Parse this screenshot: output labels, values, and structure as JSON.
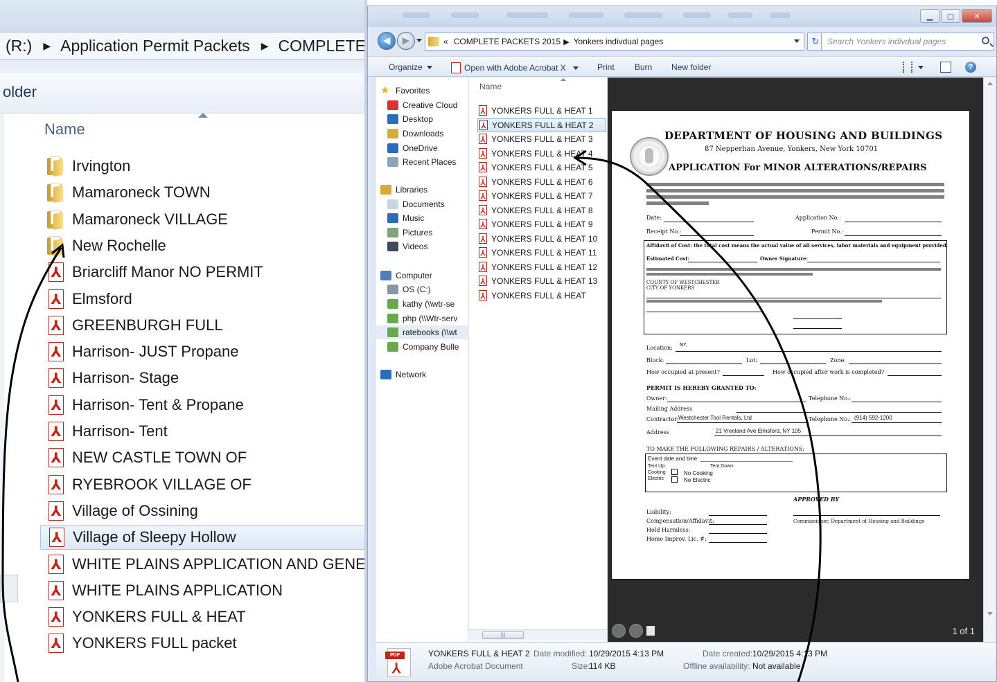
{
  "left_zoom": {
    "breadcrumb": [
      "(R:)",
      "Application Permit Packets",
      "COMPLETE PA"
    ],
    "command": "older",
    "column_header": "Name",
    "items": [
      {
        "label": "Irvington",
        "type": "folder"
      },
      {
        "label": "Mamaroneck TOWN",
        "type": "folder"
      },
      {
        "label": "Mamaroneck VILLAGE",
        "type": "folder"
      },
      {
        "label": "New Rochelle",
        "type": "folder"
      },
      {
        "label": "Briarcliff Manor NO PERMIT",
        "type": "pdf"
      },
      {
        "label": "Elmsford",
        "type": "pdf"
      },
      {
        "label": "GREENBURGH FULL",
        "type": "pdf"
      },
      {
        "label": "Harrison- JUST Propane",
        "type": "pdf"
      },
      {
        "label": "Harrison- Stage",
        "type": "pdf"
      },
      {
        "label": "Harrison- Tent & Propane",
        "type": "pdf"
      },
      {
        "label": "Harrison- Tent",
        "type": "pdf"
      },
      {
        "label": "NEW CASTLE TOWN OF",
        "type": "pdf"
      },
      {
        "label": "RYEBROOK VILLAGE OF",
        "type": "pdf"
      },
      {
        "label": "Village of  Ossining",
        "type": "pdf"
      },
      {
        "label": "Village of Sleepy Hollow",
        "type": "pdf",
        "selected": true
      },
      {
        "label": "WHITE PLAINS APPLICATION AND GENE...",
        "type": "pdf"
      },
      {
        "label": "WHITE PLAINS APPLICATION",
        "type": "pdf"
      },
      {
        "label": "YONKERS FULL & HEAT",
        "type": "pdf"
      },
      {
        "label": "YONKERS FULL packet",
        "type": "pdf"
      }
    ]
  },
  "window": {
    "address": {
      "prefix": "«",
      "parts": [
        "COMPLETE PACKETS 2015",
        "Yonkers indivdual pages"
      ]
    },
    "search_placeholder": "Search Yonkers indivdual pages",
    "toolbar": {
      "organize": "Organize",
      "open_with": "Open with Adobe Acrobat X",
      "print": "Print",
      "burn": "Burn",
      "new_folder": "New folder"
    },
    "nav_pane": [
      {
        "label": "Favorites",
        "icon": "star-icon",
        "color": "#e9b22b"
      },
      {
        "label": "Creative Cloud",
        "icon": "creative-cloud-icon",
        "color": "#d9352b"
      },
      {
        "label": "Desktop",
        "icon": "desktop-icon",
        "color": "#2e6db5"
      },
      {
        "label": "Downloads",
        "icon": "downloads-icon",
        "color": "#d9a93a"
      },
      {
        "label": "OneDrive",
        "icon": "onedrive-icon",
        "color": "#2a6bbf"
      },
      {
        "label": "Recent Places",
        "icon": "recent-places-icon",
        "color": "#8fa3bd"
      },
      {
        "label": "Libraries",
        "icon": "libraries-icon",
        "color": "#d9a93a"
      },
      {
        "label": "Documents",
        "icon": "documents-icon",
        "color": "#c9d4e2"
      },
      {
        "label": "Music",
        "icon": "music-icon",
        "color": "#2e6db5"
      },
      {
        "label": "Pictures",
        "icon": "pictures-icon",
        "color": "#7fa37a"
      },
      {
        "label": "Videos",
        "icon": "videos-icon",
        "color": "#3c4a5c"
      },
      {
        "label": "Computer",
        "icon": "computer-icon",
        "color": "#4f7fb8"
      },
      {
        "label": "OS (C:)",
        "icon": "drive-icon",
        "color": "#8a96a5"
      },
      {
        "label": "kathy (\\\\wtr-se",
        "icon": "network-drive-icon",
        "color": "#6aa84f"
      },
      {
        "label": "php (\\\\Wtr-serv",
        "icon": "network-drive-icon",
        "color": "#6aa84f"
      },
      {
        "label": "ratebooks (\\\\wt",
        "icon": "network-drive-icon",
        "color": "#6aa84f",
        "selected": true
      },
      {
        "label": "Company Bulle",
        "icon": "network-drive-icon",
        "color": "#6aa84f"
      },
      {
        "label": "Network",
        "icon": "network-icon",
        "color": "#2e6db5"
      }
    ],
    "file_header": "Name",
    "files": [
      "YONKERS FULL & HEAT 1",
      "YONKERS FULL & HEAT 2",
      "YONKERS FULL & HEAT 3",
      "YONKERS FULL & HEAT 4",
      "YONKERS FULL & HEAT 5",
      "YONKERS FULL & HEAT 6",
      "YONKERS FULL & HEAT 7",
      "YONKERS FULL & HEAT 8",
      "YONKERS FULL & HEAT 9",
      "YONKERS FULL & HEAT 10",
      "YONKERS FULL & HEAT 11",
      "YONKERS FULL & HEAT 12",
      "YONKERS FULL & HEAT 13",
      "YONKERS FULL & HEAT"
    ],
    "selected_file_index": 1,
    "preview": {
      "title": "DEPARTMENT OF HOUSING AND BUILDINGS",
      "address": "87 Nepperhan Avenue, Yonkers, New York  10701",
      "heading": "APPLICATION For MINOR ALTERATIONS/REPAIRS",
      "date_label": "Date:",
      "application_no": "Application No.:",
      "receipt_no": "Receipt No.:",
      "permit_no": "Permit No.:",
      "affidavit": "Affidavit of Cost:  the total cost means the actual value of all services, labor materials and equipment provided.",
      "estimated_cost": "Estimated Cost:",
      "owner_signature": "Owner Signature:",
      "county": "COUNTY OF WESTCHESTER",
      "city": "CITY OF YONKERS",
      "location_label": "Location:",
      "location_value": "NY,",
      "block_label": "Block:",
      "lot_label": "Lot:",
      "zone_label": "Zone:",
      "occupied_now": "How occupied at present?",
      "occupied_after": "How occupied after work is completed?",
      "permit_granted": "PERMIT IS HEREBY GRANTED TO:",
      "owner_label": "Owner:",
      "telephone_label": "Telephone No.:",
      "mailing_label": "Mailing Address",
      "contractor_label": "Contractor:",
      "contractor_value": "Westchester Tool Rentals, Ltd",
      "contractor_phone": "(914) 592-1200",
      "address_label": "Address",
      "address_value": "21 Vreeland Ave Elmsford, NY 105",
      "repairs_heading": "TO MAKE THE FOLLOWING REPAIRS / ALTERATIONS:",
      "event_line": "Event date and time: ______________________________",
      "tent_up": "Tent Up:",
      "tent_down": "Tent Down:",
      "cooking": "Cooking",
      "electric": "Electric",
      "no_cooking": "No Cooking",
      "no_electric": "No Electric",
      "approved_by": "APPROVED BY",
      "liability": "Liability:",
      "compensation": "Compensation/Affidavit:",
      "hold_harmless": "Hold Harmless:",
      "home_improv": "Home Improv. Lic. #:",
      "commissioner": "Commissioner, Department of Housing and Buildings",
      "page_count": "1 of 1"
    },
    "details": {
      "file_name": "YONKERS FULL & HEAT 2",
      "file_type": "Adobe Acrobat Document",
      "date_modified_label": "Date modified:",
      "date_modified": "10/29/2015 4:13 PM",
      "size_label": "Size:",
      "size": "114 KB",
      "date_created_label": "Date created:",
      "date_created": "10/29/2015 4:13 PM",
      "offline_label": "Offline availability:",
      "offline": "Not available",
      "pdf_badge": "PDF"
    }
  },
  "annotation_color": "#000000"
}
